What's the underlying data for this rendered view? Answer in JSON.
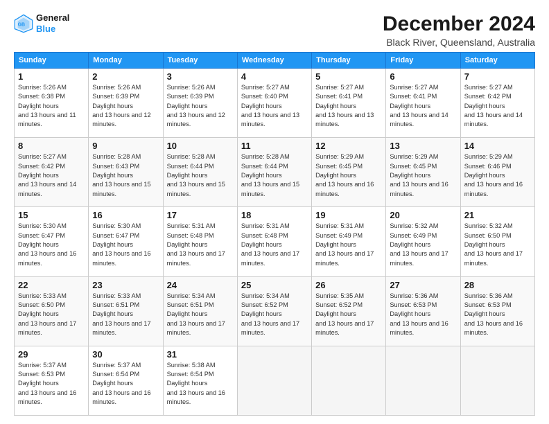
{
  "logo": {
    "line1": "General",
    "line2": "Blue"
  },
  "title": "December 2024",
  "subtitle": "Black River, Queensland, Australia",
  "headers": [
    "Sunday",
    "Monday",
    "Tuesday",
    "Wednesday",
    "Thursday",
    "Friday",
    "Saturday"
  ],
  "weeks": [
    [
      {
        "day": "1",
        "sunrise": "5:26 AM",
        "sunset": "6:38 PM",
        "daylight": "13 hours and 11 minutes."
      },
      {
        "day": "2",
        "sunrise": "5:26 AM",
        "sunset": "6:39 PM",
        "daylight": "13 hours and 12 minutes."
      },
      {
        "day": "3",
        "sunrise": "5:26 AM",
        "sunset": "6:39 PM",
        "daylight": "13 hours and 12 minutes."
      },
      {
        "day": "4",
        "sunrise": "5:27 AM",
        "sunset": "6:40 PM",
        "daylight": "13 hours and 13 minutes."
      },
      {
        "day": "5",
        "sunrise": "5:27 AM",
        "sunset": "6:41 PM",
        "daylight": "13 hours and 13 minutes."
      },
      {
        "day": "6",
        "sunrise": "5:27 AM",
        "sunset": "6:41 PM",
        "daylight": "13 hours and 14 minutes."
      },
      {
        "day": "7",
        "sunrise": "5:27 AM",
        "sunset": "6:42 PM",
        "daylight": "13 hours and 14 minutes."
      }
    ],
    [
      {
        "day": "8",
        "sunrise": "5:27 AM",
        "sunset": "6:42 PM",
        "daylight": "13 hours and 14 minutes."
      },
      {
        "day": "9",
        "sunrise": "5:28 AM",
        "sunset": "6:43 PM",
        "daylight": "13 hours and 15 minutes."
      },
      {
        "day": "10",
        "sunrise": "5:28 AM",
        "sunset": "6:44 PM",
        "daylight": "13 hours and 15 minutes."
      },
      {
        "day": "11",
        "sunrise": "5:28 AM",
        "sunset": "6:44 PM",
        "daylight": "13 hours and 15 minutes."
      },
      {
        "day": "12",
        "sunrise": "5:29 AM",
        "sunset": "6:45 PM",
        "daylight": "13 hours and 16 minutes."
      },
      {
        "day": "13",
        "sunrise": "5:29 AM",
        "sunset": "6:45 PM",
        "daylight": "13 hours and 16 minutes."
      },
      {
        "day": "14",
        "sunrise": "5:29 AM",
        "sunset": "6:46 PM",
        "daylight": "13 hours and 16 minutes."
      }
    ],
    [
      {
        "day": "15",
        "sunrise": "5:30 AM",
        "sunset": "6:47 PM",
        "daylight": "13 hours and 16 minutes."
      },
      {
        "day": "16",
        "sunrise": "5:30 AM",
        "sunset": "6:47 PM",
        "daylight": "13 hours and 16 minutes."
      },
      {
        "day": "17",
        "sunrise": "5:31 AM",
        "sunset": "6:48 PM",
        "daylight": "13 hours and 17 minutes."
      },
      {
        "day": "18",
        "sunrise": "5:31 AM",
        "sunset": "6:48 PM",
        "daylight": "13 hours and 17 minutes."
      },
      {
        "day": "19",
        "sunrise": "5:31 AM",
        "sunset": "6:49 PM",
        "daylight": "13 hours and 17 minutes."
      },
      {
        "day": "20",
        "sunrise": "5:32 AM",
        "sunset": "6:49 PM",
        "daylight": "13 hours and 17 minutes."
      },
      {
        "day": "21",
        "sunrise": "5:32 AM",
        "sunset": "6:50 PM",
        "daylight": "13 hours and 17 minutes."
      }
    ],
    [
      {
        "day": "22",
        "sunrise": "5:33 AM",
        "sunset": "6:50 PM",
        "daylight": "13 hours and 17 minutes."
      },
      {
        "day": "23",
        "sunrise": "5:33 AM",
        "sunset": "6:51 PM",
        "daylight": "13 hours and 17 minutes."
      },
      {
        "day": "24",
        "sunrise": "5:34 AM",
        "sunset": "6:51 PM",
        "daylight": "13 hours and 17 minutes."
      },
      {
        "day": "25",
        "sunrise": "5:34 AM",
        "sunset": "6:52 PM",
        "daylight": "13 hours and 17 minutes."
      },
      {
        "day": "26",
        "sunrise": "5:35 AM",
        "sunset": "6:52 PM",
        "daylight": "13 hours and 17 minutes."
      },
      {
        "day": "27",
        "sunrise": "5:36 AM",
        "sunset": "6:53 PM",
        "daylight": "13 hours and 16 minutes."
      },
      {
        "day": "28",
        "sunrise": "5:36 AM",
        "sunset": "6:53 PM",
        "daylight": "13 hours and 16 minutes."
      }
    ],
    [
      {
        "day": "29",
        "sunrise": "5:37 AM",
        "sunset": "6:53 PM",
        "daylight": "13 hours and 16 minutes."
      },
      {
        "day": "30",
        "sunrise": "5:37 AM",
        "sunset": "6:54 PM",
        "daylight": "13 hours and 16 minutes."
      },
      {
        "day": "31",
        "sunrise": "5:38 AM",
        "sunset": "6:54 PM",
        "daylight": "13 hours and 16 minutes."
      },
      null,
      null,
      null,
      null
    ]
  ]
}
